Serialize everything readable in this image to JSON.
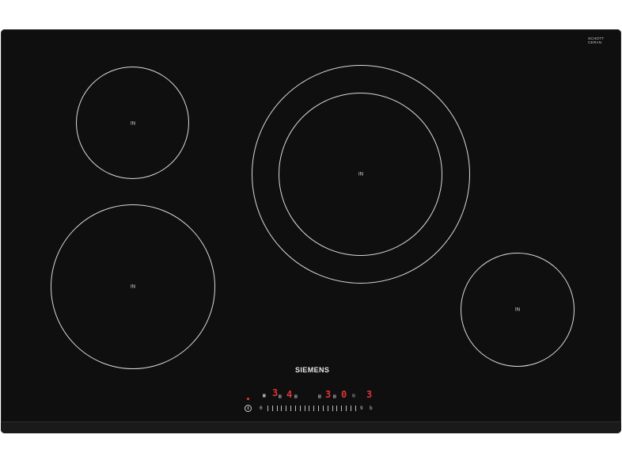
{
  "product": {
    "brand": "SIEMENS",
    "glass_brand_line1": "SCHOTT",
    "glass_brand_line2": "CERAN",
    "zone_symbol": "IN",
    "colors": {
      "glass": "#0f0f10",
      "ring": "#d9d9d9",
      "display": "#e03434"
    }
  },
  "zones": [
    {
      "id": "rear-left",
      "label": "IN"
    },
    {
      "id": "rear-center",
      "label": "IN"
    },
    {
      "id": "front-left",
      "label": "IN"
    },
    {
      "id": "front-right",
      "label": "IN"
    }
  ],
  "controls": {
    "display_digits": [
      "3",
      "4",
      "3",
      "0",
      "3"
    ],
    "slider_min": "0",
    "slider_max": "9",
    "icons": [
      "power-icon",
      "timer-icon",
      "boost-icon",
      "lock-icon"
    ]
  }
}
